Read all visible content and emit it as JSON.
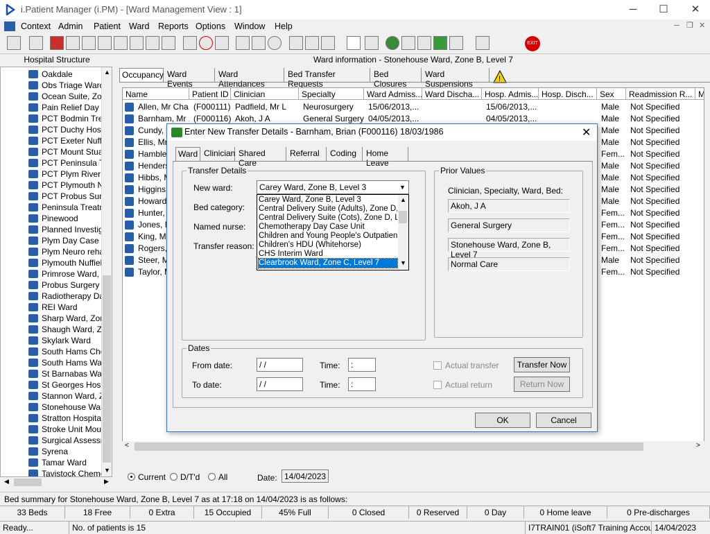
{
  "window": {
    "title": "i.Patient Manager (i.PM) - [Ward Management View : 1]",
    "min": "─",
    "max": "☐",
    "close": "✕"
  },
  "menu": [
    "Context",
    "Admin",
    "Patient",
    "Ward",
    "Reports",
    "Options",
    "Window",
    "Help"
  ],
  "left_panel": {
    "title": "Hospital Structure",
    "items": [
      "Oakdale",
      "Obs Triage Ward",
      "Ocean Suite, Zor",
      "Pain Relief Day C",
      "PCT Bodmin Trea",
      "PCT Duchy Hosp",
      "PCT Exeter Nuffie",
      "PCT Mount Stuar",
      "PCT Peninsula Tr",
      "PCT Plym River F",
      "PCT Plymouth Nu",
      "PCT Probus Surg",
      "Peninsula Treatm",
      "Pinewood",
      "Planned Investig",
      "Plym Day Case U",
      "Plym Neuro rehab",
      "Plymouth Nuffield",
      "Primrose Ward, Z",
      "Probus Surgery V",
      "Radiotherapy Day",
      "REI Ward",
      "Sharp Ward, Zon",
      "Shaugh Ward, Zo",
      "Skylark Ward",
      "South Hams Cher",
      "South Hams War",
      "St Barnabas War",
      "St Georges Hosp",
      "Stannon Ward, Z",
      "Stonehouse Ward",
      "Stratton Hospital",
      "Stroke Unit Mour",
      "Surgical Assessm",
      "Syrena",
      "Tamar Ward",
      "Tavistock Chemo"
    ]
  },
  "ward_info": "Ward information - Stonehouse Ward, Zone B, Level 7",
  "tabs": [
    "Occupancy",
    "Ward Events",
    "Ward Attendances",
    "Bed Transfer Requests",
    "Bed Closures",
    "Ward Suspensions"
  ],
  "grid": {
    "headers": [
      "Name",
      "Patient ID",
      "Clinician",
      "Specialty",
      "Ward Admiss...",
      "Ward Discha...",
      "Hosp. Admis...",
      "Hosp. Disch...",
      "Sex",
      "Readmission R...",
      "M"
    ],
    "rows": [
      [
        "Allen, Mr Cha...",
        "(F000111)",
        "Padfield, Mr L",
        "Neurosurgery",
        "15/06/2013,...",
        "",
        "15/06/2013,...",
        "",
        "Male",
        "Not Specified"
      ],
      [
        "Barnham, Mr ...",
        "(F000116)",
        "Akoh, J A",
        "General Surgery",
        "04/05/2013,...",
        "",
        "04/05/2013,...",
        "",
        "Male",
        "Not Specified"
      ],
      [
        "Cundy, M",
        "",
        "",
        "",
        "",
        "",
        "",
        "",
        "Male",
        "Not Specified"
      ],
      [
        "Ellis, Mr C",
        "",
        "",
        "",
        "",
        "",
        "",
        "",
        "Male",
        "Not Specified"
      ],
      [
        "Hambley,",
        "",
        "",
        "",
        "",
        "",
        "",
        "",
        "Fem...",
        "Not Specified"
      ],
      [
        "Henderso",
        "",
        "",
        "",
        "",
        "",
        "",
        "",
        "Male",
        "Not Specified"
      ],
      [
        "Hibbs, M",
        "",
        "",
        "",
        "",
        "",
        "",
        "",
        "Male",
        "Not Specified"
      ],
      [
        "Higgins, I",
        "",
        "",
        "",
        "",
        "",
        "",
        "",
        "Male",
        "Not Specified"
      ],
      [
        "Howard,",
        "",
        "",
        "",
        "",
        "",
        "",
        "",
        "Male",
        "Not Specified"
      ],
      [
        "Hunter, M",
        "",
        "",
        "",
        "",
        "",
        "",
        "",
        "Fem...",
        "Not Specified"
      ],
      [
        "Jones, M",
        "",
        "",
        "",
        "",
        "",
        "",
        "",
        "Fem...",
        "Not Specified"
      ],
      [
        "King, Mrs",
        "",
        "",
        "",
        "",
        "",
        "",
        "",
        "Fem...",
        "Not Specified"
      ],
      [
        "Rogers, M",
        "",
        "",
        "",
        "",
        "",
        "",
        "",
        "Fem...",
        "Not Specified"
      ],
      [
        "Steer, Mr",
        "",
        "",
        "",
        "",
        "",
        "",
        "",
        "Male",
        "Not Specified"
      ],
      [
        "Taylor, M",
        "",
        "",
        "",
        "",
        "",
        "",
        "",
        "Fem...",
        "Not Specified"
      ]
    ]
  },
  "filter": {
    "current": "Current",
    "dtd": "D/T'd",
    "all": "All",
    "date_label": "Date:",
    "date": "14/04/2023"
  },
  "dialog": {
    "title": "Enter New Transfer Details - Barnham, Brian (F000116) 18/03/1986",
    "tabs": [
      "Ward",
      "Clinician",
      "Shared Care",
      "Referral",
      "Coding",
      "Home Leave"
    ],
    "transfer_legend": "Transfer Details",
    "new_ward_label": "New ward:",
    "new_ward_value": "Carey Ward, Zone B, Level 3",
    "bed_cat_label": "Bed category:",
    "named_nurse_label": "Named nurse:",
    "reason_label": "Transfer reason:",
    "options": [
      "Carey Ward, Zone B, Level 3",
      "Central Delivery Suite (Adults), Zone D, Le",
      "Central Delivery Suite (Cots), Zone D, Leve",
      "Chemotherapy Day Case Unit",
      "Children and Young People's Outpatient D",
      "Children's HDU (Whitehorse)",
      "CHS Interim Ward",
      "Clearbrook Ward, Zone C, Level 7"
    ],
    "prior_legend": "Prior Values",
    "prior_label": "Clinician, Specialty, Ward, Bed:",
    "prior": [
      "Akoh, J A",
      "General Surgery",
      "Stonehouse Ward, Zone B, Level 7",
      "Normal Care"
    ],
    "dates_legend": "Dates",
    "from_label": "From date:",
    "to_label": "To date:",
    "time_label": "Time:",
    "date_blank": " / /",
    "time_blank": " :",
    "actual_transfer": "Actual transfer",
    "actual_return": "Actual return",
    "transfer_now": "Transfer Now",
    "return_now": "Return Now",
    "ok": "OK",
    "cancel": "Cancel",
    "close": "✕"
  },
  "summary": "Bed summary for Stonehouse Ward, Zone B, Level 7 as at 17:18 on 14/04/2023 is as follows:",
  "stats": [
    "33 Beds",
    "18 Free",
    "0 Extra",
    "15 Occupied",
    "45% Full",
    "0 Closed",
    "0 Reserved",
    "0 Day",
    "0 Home leave",
    "0 Pre-discharges"
  ],
  "statusbar": {
    "ready": "Ready...",
    "patients": "No. of patients is 15",
    "user": "I7TRAIN01 (iSoft7 Training Account)",
    "date": "14/04/2023"
  }
}
